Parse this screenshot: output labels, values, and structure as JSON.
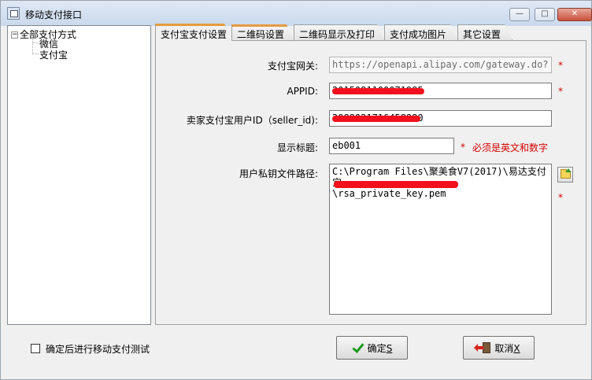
{
  "window": {
    "title": "移动支付接口",
    "minimize": "—",
    "maximize": "□",
    "close": "✕"
  },
  "tree": {
    "root_expander": "⊟",
    "root": "全部支付方式",
    "children": [
      "微信",
      "支付宝"
    ]
  },
  "tabs": [
    "支付宝支付设置",
    "二维码设置",
    "二维码显示及打印",
    "支付成功图片",
    "其它设置"
  ],
  "form": {
    "gateway_label": "支付宝网关:",
    "gateway_value": "https://openapi.alipay.com/gateway.do?",
    "appid_label": "APPID:",
    "appid_value": "2015081100071985",
    "seller_label": "卖家支付宝用户ID（seller_id):",
    "seller_value": "2088021716458880",
    "title_label": "显示标题:",
    "title_value": "eb001",
    "title_note": "必须是英文和数字",
    "keypath_label": "用户私钥文件路径:",
    "keypath_value": "C:\\Program Files\\聚美食V7(2017)\\易达支付\n宝\n\\rsa_private_key.pem",
    "required_mark": "*"
  },
  "footer": {
    "test_label": "确定后进行移动支付测试",
    "test_checked": false,
    "ok_label": "确定",
    "ok_key": "S",
    "cancel_label": "取消",
    "cancel_key": "X"
  },
  "colors": {
    "accent_tab": "#e49b41",
    "required": "#d40000",
    "redaction": "#f2101e"
  }
}
